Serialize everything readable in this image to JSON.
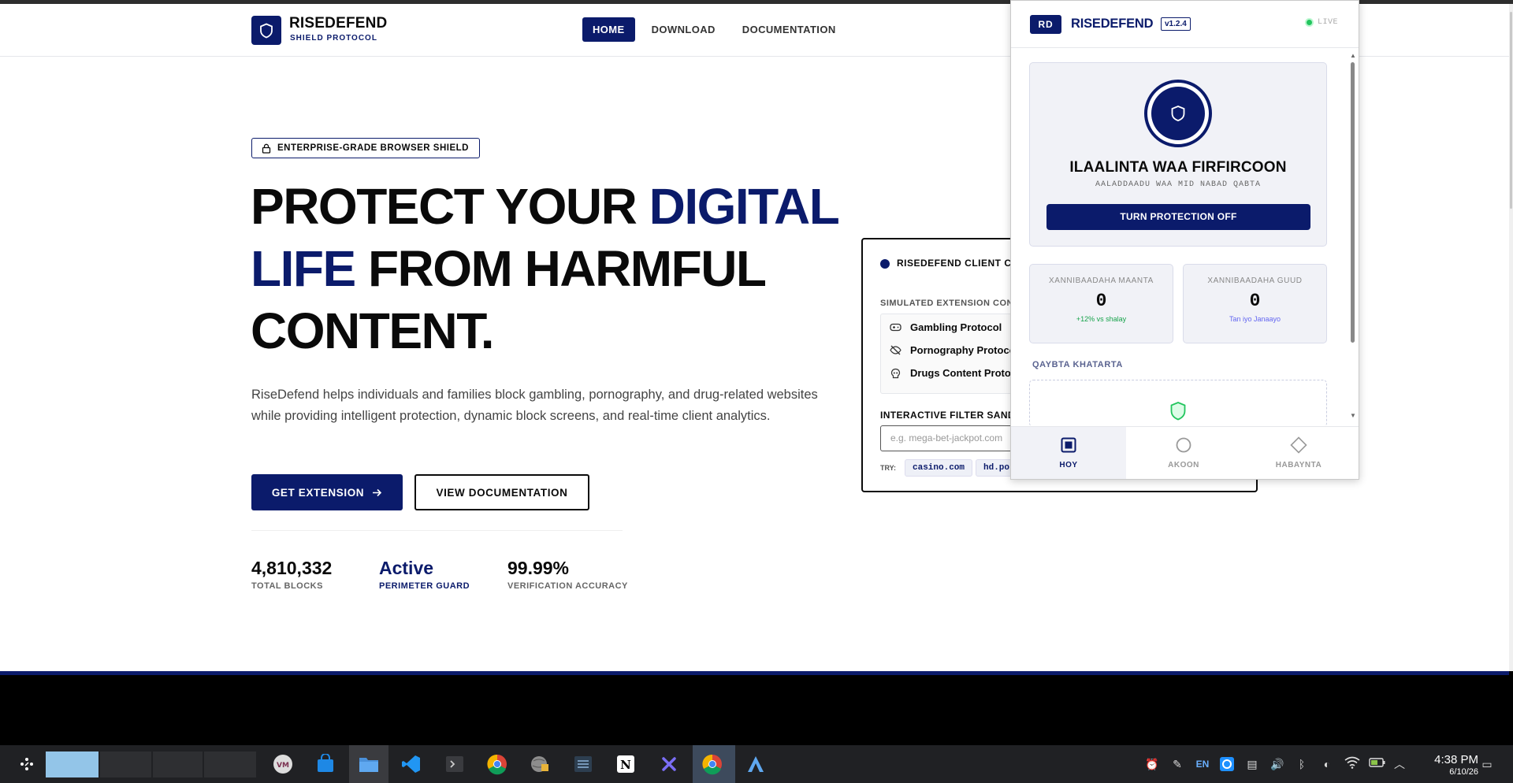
{
  "header": {
    "brand": "RISEDEFEND",
    "brand_sub": "SHIELD PROTOCOL",
    "nav": [
      {
        "label": "HOME",
        "active": true
      },
      {
        "label": "DOWNLOAD",
        "active": false
      },
      {
        "label": "DOCUMENTATION",
        "active": false
      }
    ]
  },
  "hero": {
    "badge": "ENTERPRISE-GRADE BROWSER SHIELD",
    "title_part1": "PROTECT YOUR ",
    "title_accent1": "DIGITAL",
    "title_accent2": "LIFE",
    "title_part2": " FROM HARMFUL",
    "title_part3": "CONTENT.",
    "description": "RiseDefend helps individuals and families block gambling, pornography, and drug-related websites while providing intelligent protection, dynamic block screens, and real-time client analytics.",
    "cta_primary": "GET EXTENSION",
    "cta_secondary": "VIEW DOCUMENTATION",
    "stats": [
      {
        "value": "4,810,332",
        "label": "TOTAL BLOCKS"
      },
      {
        "value": "Active",
        "label": "PERIMETER GUARD"
      },
      {
        "value": "99.99%",
        "label": "VERIFICATION ACCURACY"
      }
    ]
  },
  "client_card": {
    "title": "RISEDEFEND CLIENT CO",
    "simulated_label": "SIMULATED EXTENSION CONT",
    "protocols": [
      "Gambling Protocol",
      "Pornography Protoco",
      "Drugs Content Protoc"
    ],
    "filter_label": "INTERACTIVE FILTER SANDE",
    "input_placeholder": "e.g. mega-bet-jackpot.com",
    "try_label": "TRY:",
    "chips": [
      "casino.com",
      "hd.por"
    ]
  },
  "popup": {
    "logo": "RD",
    "brand": "RISEDEFEND",
    "version": "v1.2.4",
    "status": "LIVE",
    "status_color": "#22c55e",
    "title": "ILAALINTA WAA FIRFIRCOON",
    "subtitle": "AALADDAADU WAA MID NABAD QABTA",
    "toggle_label": "TURN PROTECTION OFF",
    "stats": [
      {
        "label": "XANNIBAADAHA MAANTA",
        "value": "0",
        "note": "+12% vs shalay",
        "note_color": "#16a34a"
      },
      {
        "label": "XANNIBAADAHA GUUD",
        "value": "0",
        "note": "Tan iyo Janaayo",
        "note_color": "#6366f1"
      }
    ],
    "section_label": "QAYBTA KHATARTA",
    "tabs": [
      {
        "label": "HOY",
        "icon": "home-square-icon",
        "active": true
      },
      {
        "label": "AKOON",
        "icon": "account-circle-icon",
        "active": false
      },
      {
        "label": "HABAYNTA",
        "icon": "settings-diamond-icon",
        "active": false
      }
    ]
  },
  "taskbar": {
    "language": "EN",
    "time": "4:38 PM",
    "date": "6/10/26"
  },
  "colors": {
    "brand_navy": "#0b1b6b",
    "live_green": "#22c55e"
  }
}
